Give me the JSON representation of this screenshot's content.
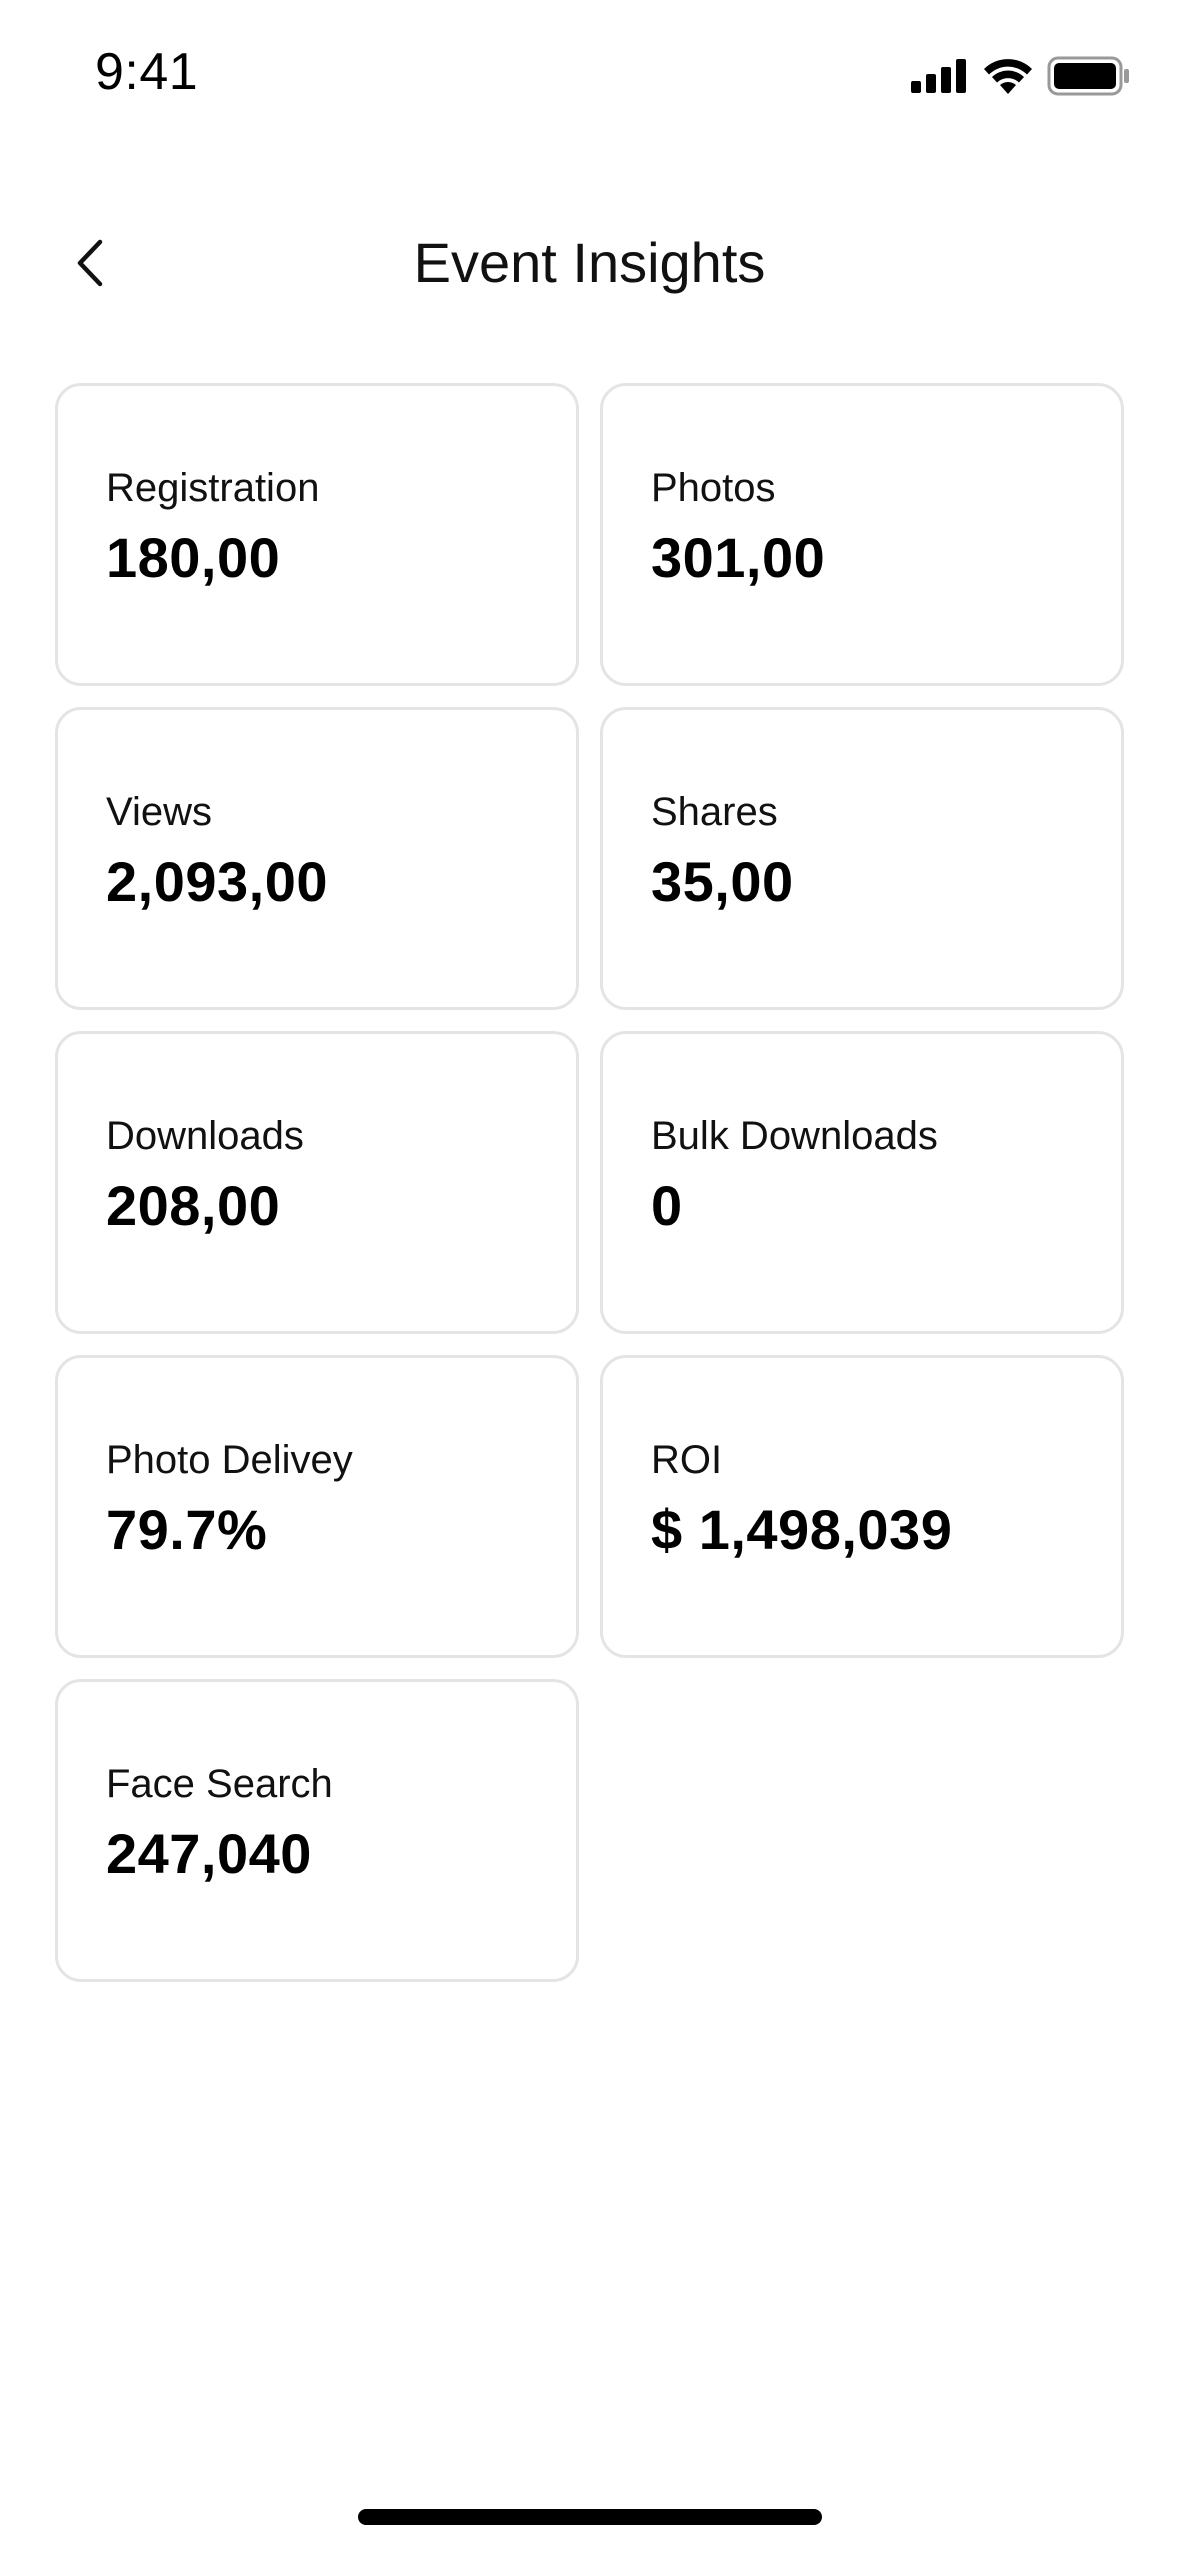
{
  "status_bar": {
    "time": "9:41",
    "icons": [
      "cellular-signal-icon",
      "wifi-icon",
      "battery-icon"
    ]
  },
  "header": {
    "back_icon": "chevron-left-icon",
    "title": "Event Insights"
  },
  "metrics": [
    {
      "label": "Registration",
      "value": "180,00"
    },
    {
      "label": "Photos",
      "value": "301,00"
    },
    {
      "label": "Views",
      "value": "2,093,00"
    },
    {
      "label": "Shares",
      "value": "35,00"
    },
    {
      "label": "Downloads",
      "value": "208,00"
    },
    {
      "label": "Bulk Downloads",
      "value": "0"
    },
    {
      "label": "Photo Delivey",
      "value": "79.7%"
    },
    {
      "label": "ROI",
      "value": "$ 1,498,039"
    },
    {
      "label": "Face Search",
      "value": "247,040"
    }
  ],
  "colors": {
    "background": "#ffffff",
    "card_border": "#e4e4e4",
    "text": "#111111"
  }
}
